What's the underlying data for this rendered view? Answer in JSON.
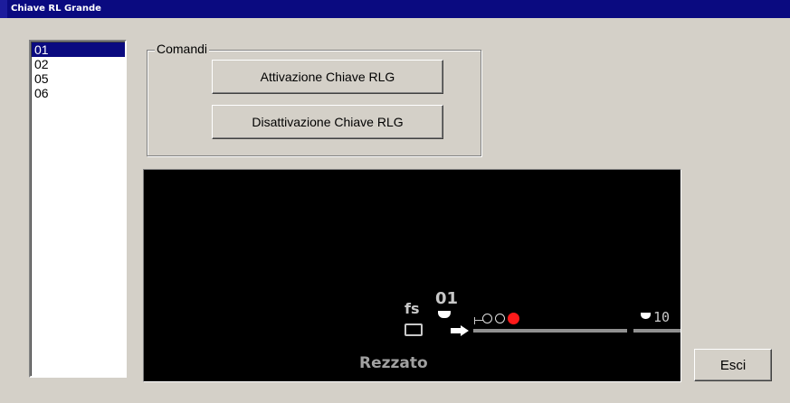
{
  "window": {
    "title": "Chiave RL Grande"
  },
  "list": {
    "items": [
      "01",
      "02",
      "05",
      "06"
    ],
    "selected_index": 0
  },
  "comandi": {
    "label": "Comandi",
    "attiva_label": "Attivazione Chiave RLG",
    "disattiva_label": "Disattivazione Chiave RLG"
  },
  "diagram": {
    "fs_label": "fs",
    "signal_number": "01",
    "station_name": "Rezzato",
    "next_signal_number": "10",
    "colors": {
      "background": "#000000",
      "lamp_active": "#ff1a1a",
      "track": "#909090"
    },
    "icons": [
      "signal-head-icon",
      "direction-arrow-icon",
      "signal-lamp-icon",
      "fs-box-icon"
    ]
  },
  "footer": {
    "esci_label": "Esci"
  },
  "colors": {
    "titlebar": "#0a0a80",
    "face": "#d4d0c8",
    "selection": "#0a0a80"
  }
}
